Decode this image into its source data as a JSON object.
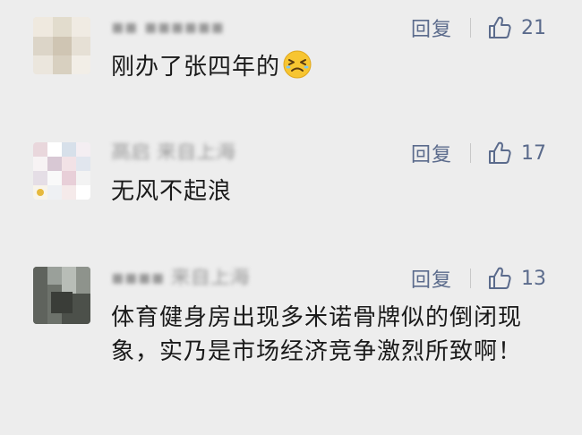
{
  "comments": [
    {
      "user_name": "▪▪ ▪▪▪▪▪▪",
      "reply_label": "回复",
      "likes": "21",
      "text": "刚办了张四年的",
      "emoji_icon": "persevering-face-icon"
    },
    {
      "user_name": "高启 来自上海",
      "reply_label": "回复",
      "likes": "17",
      "text": "无风不起浪"
    },
    {
      "user_name": "▪▪▪▪ 来自上海",
      "reply_label": "回复",
      "likes": "13",
      "text": "体育健身房出现多米诺骨牌似的倒闭现象，实乃是市场经济竞争激烈所致啊！"
    }
  ],
  "colors": {
    "background": "#ededed",
    "accent_text": "#5b6b8c",
    "body_text": "#1a1a1a"
  }
}
